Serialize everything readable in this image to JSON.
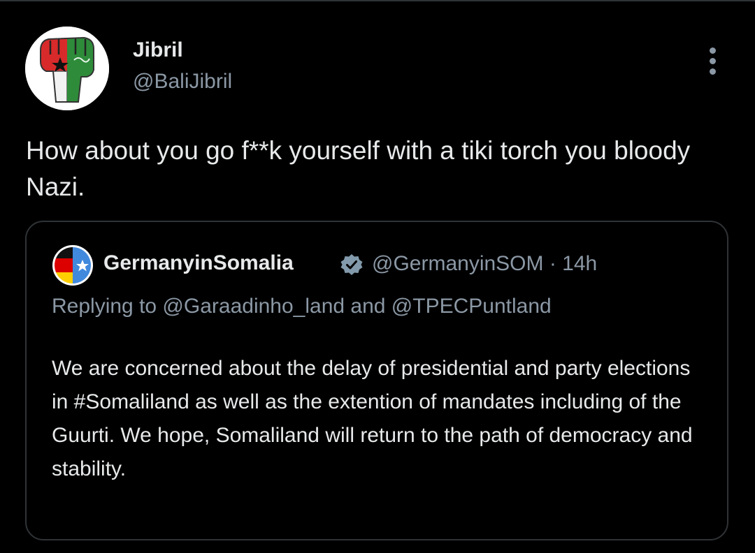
{
  "author": {
    "display_name": "Jibril",
    "handle": "@BaliJibril",
    "avatar_icon": "raised-fist-flag-icon"
  },
  "tweet": {
    "text": "How about you go f**k yourself with a tiki torch you bloody Nazi."
  },
  "quoted_tweet": {
    "display_name": "GermanyinSomalia",
    "verified_icon": "verified-badge-icon",
    "meta": "@GermanyinSOM · 14h",
    "replying_to": "Replying to @Garaadinho_land and @TPECPuntland",
    "text": "We are concerned about the delay of presidential and party elections in #Somaliland as well as the extention of mandates including of the Guurti. We hope, Somaliland will return to the path of democracy and stability.",
    "avatar_icon": "germany-somalia-flag-icon"
  },
  "colors": {
    "background": "#000000",
    "text_primary": "#e7e9ea",
    "text_secondary": "#8b98a5",
    "border": "#2f3336"
  }
}
